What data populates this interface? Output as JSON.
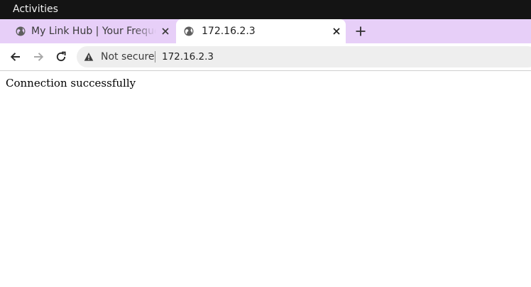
{
  "system_bar": {
    "activities_label": "Activities"
  },
  "tabs": [
    {
      "title": "My Link Hub | Your Frequently Used Links",
      "active": false,
      "icon": "globe-icon"
    },
    {
      "title": "172.16.2.3",
      "active": true,
      "icon": "globe-icon"
    }
  ],
  "address_bar": {
    "security_label": "Not secure",
    "url": "172.16.2.3"
  },
  "page": {
    "message": "Connection successfully"
  },
  "colors": {
    "tabstrip": "#e7cff8",
    "system_bar": "#141414",
    "omnibox": "#eeeeee"
  }
}
